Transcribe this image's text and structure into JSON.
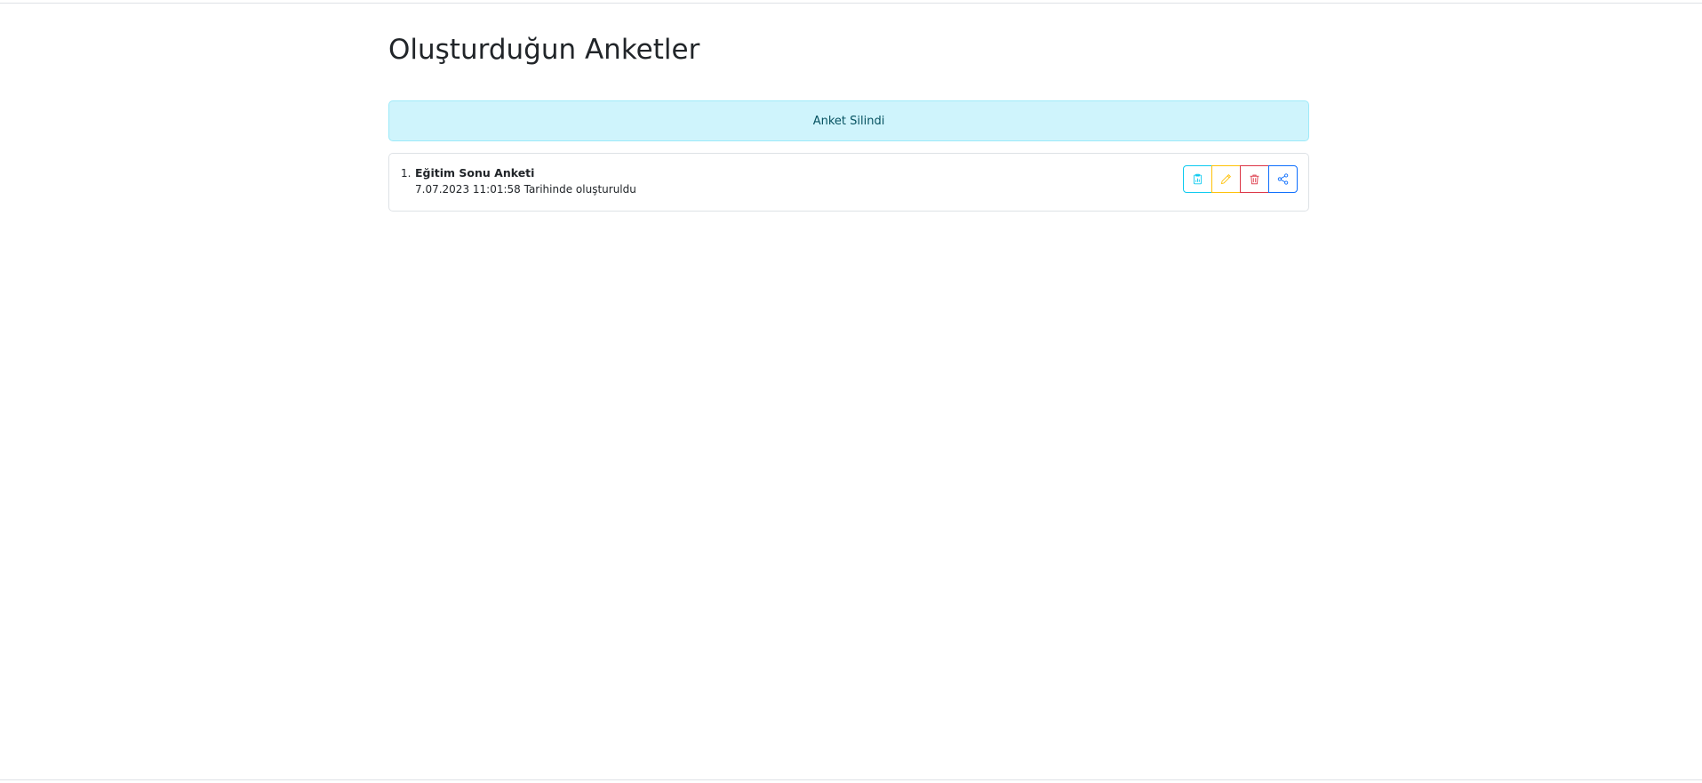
{
  "page": {
    "title": "Oluşturduğun Anketler"
  },
  "alert": {
    "message": "Anket Silindi",
    "color": "#cff4fc"
  },
  "surveys": [
    {
      "number": "1.",
      "title": "Eğitim Sonu Anketi",
      "created": "7.07.2023 11:01:58 Tarihinde oluşturuldu"
    }
  ],
  "actions": [
    {
      "icon": "clipboard-chart-icon",
      "color": "#0dcaf0"
    },
    {
      "icon": "pencil-icon",
      "color": "#ffc107"
    },
    {
      "icon": "trash-icon",
      "color": "#dc3545"
    },
    {
      "icon": "share-icon",
      "color": "#0d6efd"
    }
  ]
}
